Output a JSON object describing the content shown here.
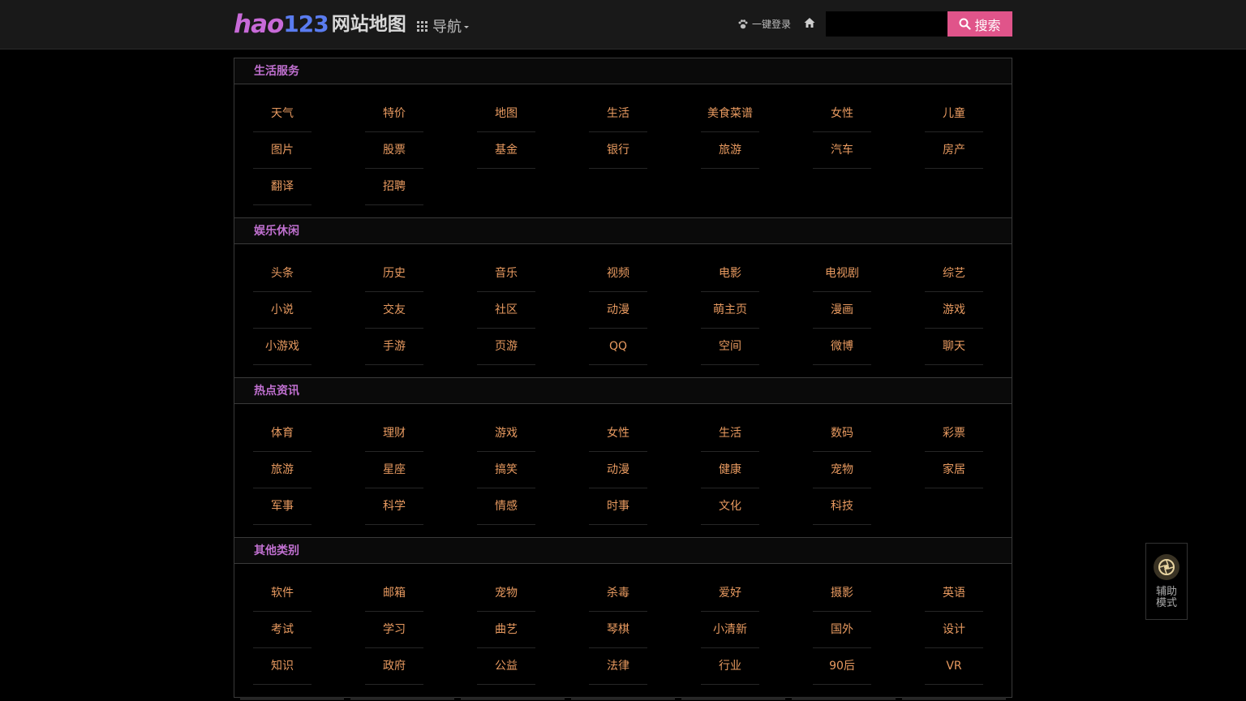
{
  "header": {
    "logo_hao": "hao",
    "logo_num": "123",
    "logo_site": "网站地图",
    "nav_label": "导航",
    "login_label": "一键登录",
    "search_placeholder": "",
    "search_label": "搜索"
  },
  "sections": [
    {
      "title": "生活服务",
      "items": [
        "天气",
        "特价",
        "地图",
        "生活",
        "美食菜谱",
        "女性",
        "儿童",
        "图片",
        "股票",
        "基金",
        "银行",
        "旅游",
        "汽车",
        "房产",
        "翻译",
        "招聘",
        "",
        "",
        "",
        "",
        ""
      ]
    },
    {
      "title": "娱乐休闲",
      "items": [
        "头条",
        "历史",
        "音乐",
        "视频",
        "电影",
        "电视剧",
        "综艺",
        "小说",
        "交友",
        "社区",
        "动漫",
        "萌主页",
        "漫画",
        "游戏",
        "小游戏",
        "手游",
        "页游",
        "QQ",
        "空间",
        "微博",
        "聊天"
      ]
    },
    {
      "title": "热点资讯",
      "items": [
        "体育",
        "理财",
        "游戏",
        "女性",
        "生活",
        "数码",
        "彩票",
        "旅游",
        "星座",
        "搞笑",
        "动漫",
        "健康",
        "宠物",
        "家居",
        "军事",
        "科学",
        "情感",
        "时事",
        "文化",
        "科技",
        ""
      ]
    },
    {
      "title": "其他类别",
      "items": [
        "软件",
        "邮箱",
        "宠物",
        "杀毒",
        "爱好",
        "摄影",
        "英语",
        "考试",
        "学习",
        "曲艺",
        "琴棋",
        "小清新",
        "国外",
        "设计",
        "知识",
        "政府",
        "公益",
        "法律",
        "行业",
        "90后",
        "VR"
      ]
    }
  ],
  "assist": {
    "label_line1": "辅助",
    "label_line2": "模式"
  },
  "colors": {
    "accent": "#e0548a",
    "link": "#e89a60",
    "section_title": "#c070d0",
    "header_bg": "#191919"
  }
}
